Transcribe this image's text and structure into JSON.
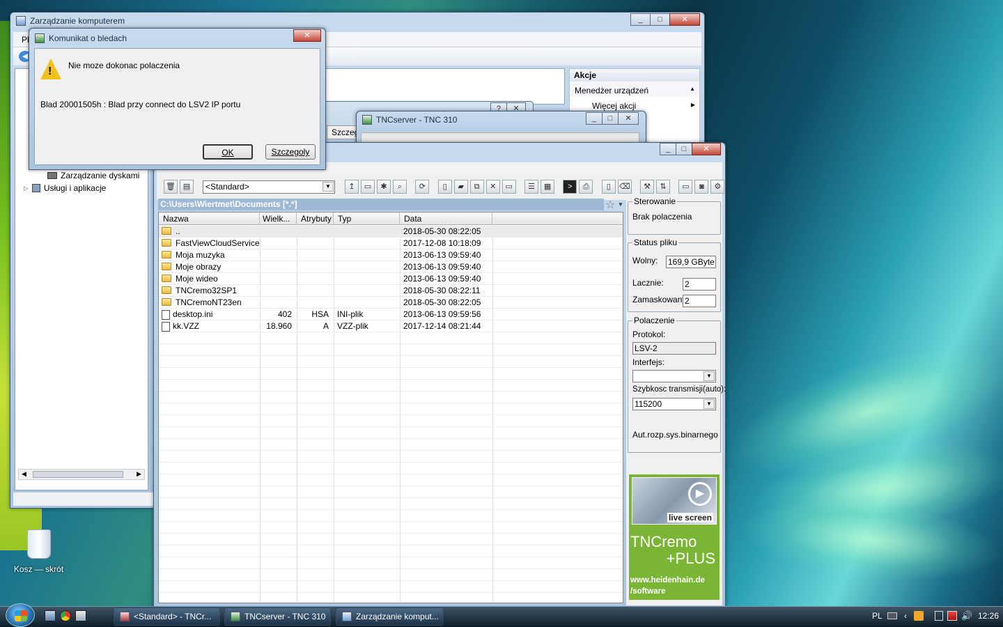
{
  "desktop": {
    "recycle_label": "Kosz — skrót"
  },
  "computer_mgmt": {
    "title": "Zarządzanie komputerem",
    "menu_partial": "Pl",
    "actions_header": "Akcje",
    "actions_item": "Menedżer urządzeń",
    "actions_more": "Więcej akcji",
    "tree_items": [
      "Zarządzanie dyskami",
      "Usługi i aplikacje"
    ],
    "dialog_tab_partial": "Szczeg"
  },
  "error_dialog": {
    "title": "Komunikat o bledach",
    "message": "Nie moze dokonac polaczenia",
    "detail": "Blad 20001505h : Blad przy connect do LSV2 IP portu",
    "ok_label": "OK",
    "details_label": "Szczegoly"
  },
  "tncserver": {
    "title": "TNCserver - TNC 310"
  },
  "tncremo": {
    "filter_value": "<Standard>",
    "path": "C:\\Users\\Wiertmet\\Documents [*.*]",
    "columns": [
      "Nazwa",
      "Wielk...",
      "Atrybuty",
      "Typ",
      "Data"
    ],
    "rows": [
      {
        "name": "..",
        "size": "",
        "attr": "",
        "type": "",
        "date": "2018-05-30 08:22:05",
        "kind": "folder"
      },
      {
        "name": "FastViewCloudService",
        "size": "",
        "attr": "",
        "type": "",
        "date": "2017-12-08 10:18:09",
        "kind": "folder"
      },
      {
        "name": "Moja muzyka",
        "size": "",
        "attr": "",
        "type": "",
        "date": "2013-06-13 09:59:40",
        "kind": "folder"
      },
      {
        "name": "Moje obrazy",
        "size": "",
        "attr": "",
        "type": "",
        "date": "2013-06-13 09:59:40",
        "kind": "folder"
      },
      {
        "name": "Moje wideo",
        "size": "",
        "attr": "",
        "type": "",
        "date": "2013-06-13 09:59:40",
        "kind": "folder"
      },
      {
        "name": "TNCremo32SP1",
        "size": "",
        "attr": "",
        "type": "",
        "date": "2018-05-30 08:22:11",
        "kind": "folder"
      },
      {
        "name": "TNCremoNT23en",
        "size": "",
        "attr": "",
        "type": "",
        "date": "2018-05-30 08:22:05",
        "kind": "folder"
      },
      {
        "name": "desktop.ini",
        "size": "402",
        "attr": "HSA",
        "type": "INI-plik",
        "date": "2013-06-13 09:59:56",
        "kind": "file"
      },
      {
        "name": "kk.VZZ",
        "size": "18.960",
        "attr": "A",
        "type": "VZZ-plik",
        "date": "2017-12-14 08:21:44",
        "kind": "file"
      }
    ],
    "control": {
      "group_label": "Sterowanie",
      "status": "Brak polaczenia"
    },
    "file_status": {
      "group_label": "Status pliku",
      "free_label": "Wolny:",
      "free_value": "169,9 GByte",
      "total_label": "Lacznie:",
      "total_value": "2",
      "masked_label": "Zamaskowany:",
      "masked_value": "2"
    },
    "connection": {
      "group_label": "Polaczenie",
      "protocol_label": "Protokol:",
      "protocol_value": "LSV-2",
      "interface_label": "Interfejs:",
      "interface_value": "",
      "speed_label": "Szybkosc transmisji(auto):",
      "speed_value": "115200",
      "binary_label": "Aut.rozp.sys.binarnego"
    },
    "ad": {
      "live_label": "live screen",
      "brand_line1": "TNCremo",
      "brand_line2": "+PLUS",
      "url_line1": "www.heidenhain.de",
      "url_line2": "/software",
      "bg_color": "#7bb535"
    }
  },
  "taskbar": {
    "items": [
      "<Standard> - TNCr...",
      "TNCserver - TNC 310",
      "Zarządzanie komput..."
    ],
    "lang": "PL",
    "time": "12:26"
  }
}
